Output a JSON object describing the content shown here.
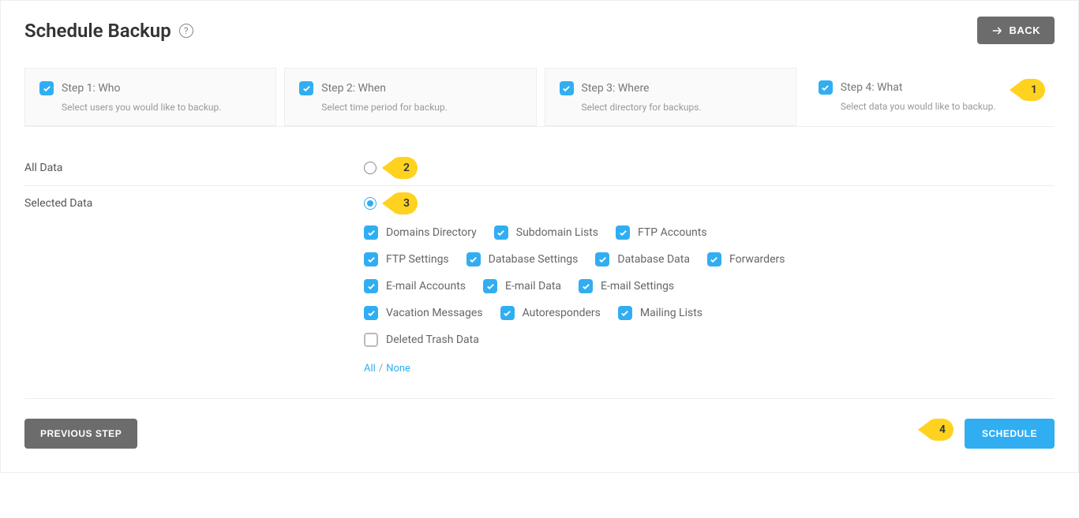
{
  "header": {
    "title": "Schedule Backup",
    "back_label": "BACK"
  },
  "steps": [
    {
      "title": "Step 1: Who",
      "desc": "Select users you would like to backup."
    },
    {
      "title": "Step 2: When",
      "desc": "Select time period for backup."
    },
    {
      "title": "Step 3: Where",
      "desc": "Select directory for backups."
    },
    {
      "title": "Step 4: What",
      "desc": "Select data you would like to backup."
    }
  ],
  "options": {
    "all_data_label": "All Data",
    "selected_data_label": "Selected Data"
  },
  "checkboxes": {
    "domains_directory": "Domains Directory",
    "subdomain_lists": "Subdomain Lists",
    "ftp_accounts": "FTP Accounts",
    "ftp_settings": "FTP Settings",
    "database_settings": "Database Settings",
    "database_data": "Database Data",
    "forwarders": "Forwarders",
    "email_accounts": "E-mail Accounts",
    "email_data": "E-mail Data",
    "email_settings": "E-mail Settings",
    "vacation_messages": "Vacation Messages",
    "autoresponders": "Autoresponders",
    "mailing_lists": "Mailing Lists",
    "deleted_trash": "Deleted Trash Data"
  },
  "links": {
    "all": "All",
    "none": "None"
  },
  "footer": {
    "prev": "PREVIOUS STEP",
    "schedule": "SCHEDULE"
  },
  "callouts": {
    "n1": "1",
    "n2": "2",
    "n3": "3",
    "n4": "4"
  }
}
